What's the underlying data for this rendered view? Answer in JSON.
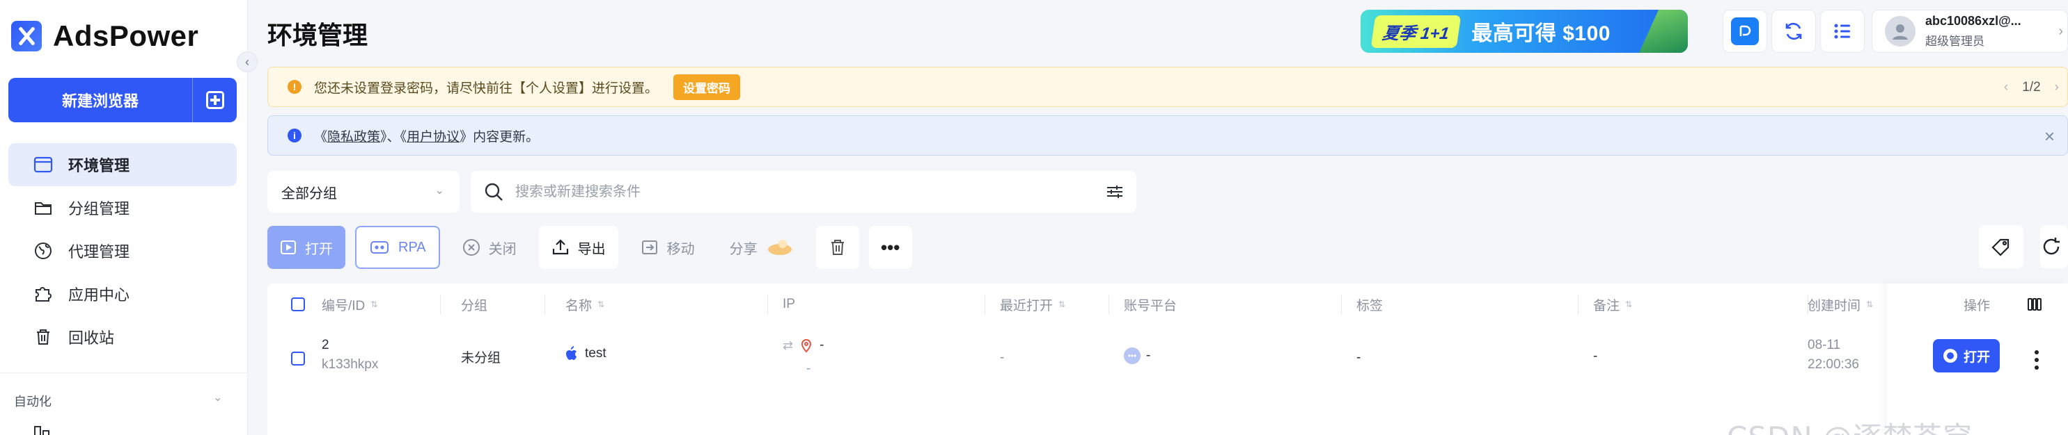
{
  "app": {
    "name": "AdsPower",
    "page_title": "环境管理"
  },
  "sidebar": {
    "new_browser_label": "新建浏览器",
    "items": [
      {
        "label": "环境管理",
        "icon": "browser-window-icon",
        "active": true
      },
      {
        "label": "分组管理",
        "icon": "folder-icon",
        "active": false
      },
      {
        "label": "代理管理",
        "icon": "globe-icon",
        "active": false
      },
      {
        "label": "应用中心",
        "icon": "puzzle-icon",
        "active": false
      },
      {
        "label": "回收站",
        "icon": "trash-icon",
        "active": false
      }
    ],
    "section_title": "自动化"
  },
  "header": {
    "promo_tag": "夏季 1+1",
    "promo_text": "最高可得 $100",
    "user_name": "abc10086xzl@...",
    "user_role": "超级管理员"
  },
  "notices": {
    "warning_text": "您还未设置登录密码，请尽快前往【个人设置】进行设置。",
    "warning_button": "设置密码",
    "pager": "1/2",
    "info_prefix": "《",
    "info_link1": "隐私政策",
    "info_mid": "》、《",
    "info_link2": "用户协议",
    "info_suffix": "》内容更新。"
  },
  "filters": {
    "group_select": "全部分组",
    "search_placeholder": "搜索或新建搜索条件"
  },
  "toolbar": {
    "open": "打开",
    "rpa": "RPA",
    "close": "关闭",
    "export": "导出",
    "move": "移动",
    "share": "分享"
  },
  "table": {
    "columns": [
      "编号/ID",
      "分组",
      "名称",
      "IP",
      "最近打开",
      "账号平台",
      "标签",
      "备注",
      "创建时间",
      "操作"
    ],
    "rows": [
      {
        "number": "2",
        "id": "k133hkpx",
        "group": "未分组",
        "name": "test",
        "ip_primary": "-",
        "ip_secondary": "-",
        "last_opened": "-",
        "platform": "-",
        "tags": "-",
        "remark": "-",
        "created_date": "08-11",
        "created_time": "22:00:36",
        "action": "打开"
      }
    ]
  },
  "watermark": "CSDN @逐梦苍穹",
  "colors": {
    "primary": "#2f58f7",
    "warning": "#f5a623",
    "info_bg": "#e9f0fc"
  }
}
